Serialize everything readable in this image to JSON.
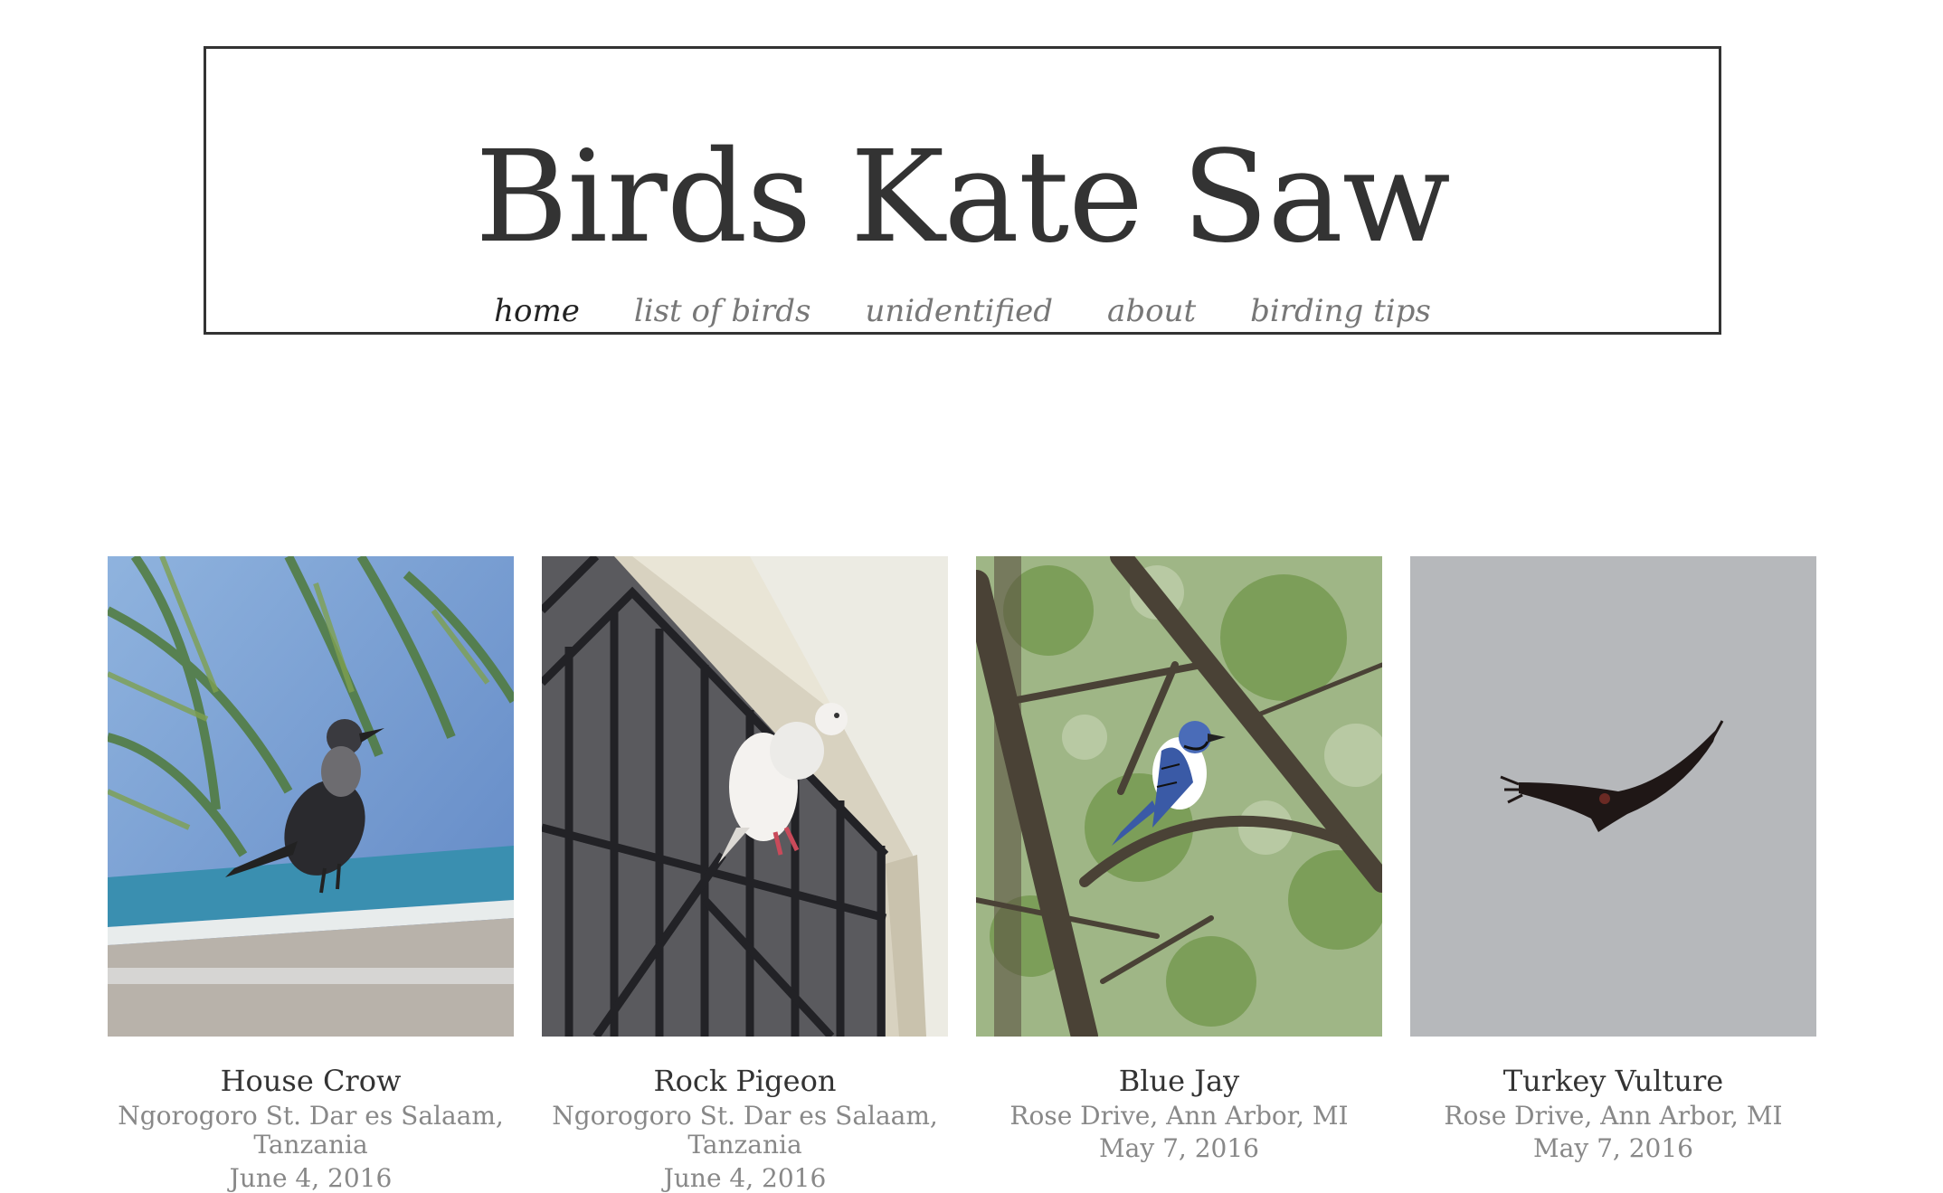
{
  "site": {
    "title": "Birds Kate Saw"
  },
  "nav": [
    {
      "label": "home",
      "active": true
    },
    {
      "label": "list of birds",
      "active": false
    },
    {
      "label": "unidentified",
      "active": false
    },
    {
      "label": "about",
      "active": false
    },
    {
      "label": "birding tips",
      "active": false
    }
  ],
  "cards": [
    {
      "name": "House Crow",
      "location": "Ngorogoro St. Dar es Salaam, Tanzania",
      "date": "June 4, 2016"
    },
    {
      "name": "Rock Pigeon",
      "location": "Ngorogoro St. Dar es Salaam, Tanzania",
      "date": "June 4, 2016"
    },
    {
      "name": "Blue Jay",
      "location": "Rose Drive, Ann Arbor, MI",
      "date": "May 7, 2016"
    },
    {
      "name": "Turkey Vulture",
      "location": "Rose Drive, Ann Arbor, MI",
      "date": "May 7, 2016"
    }
  ]
}
